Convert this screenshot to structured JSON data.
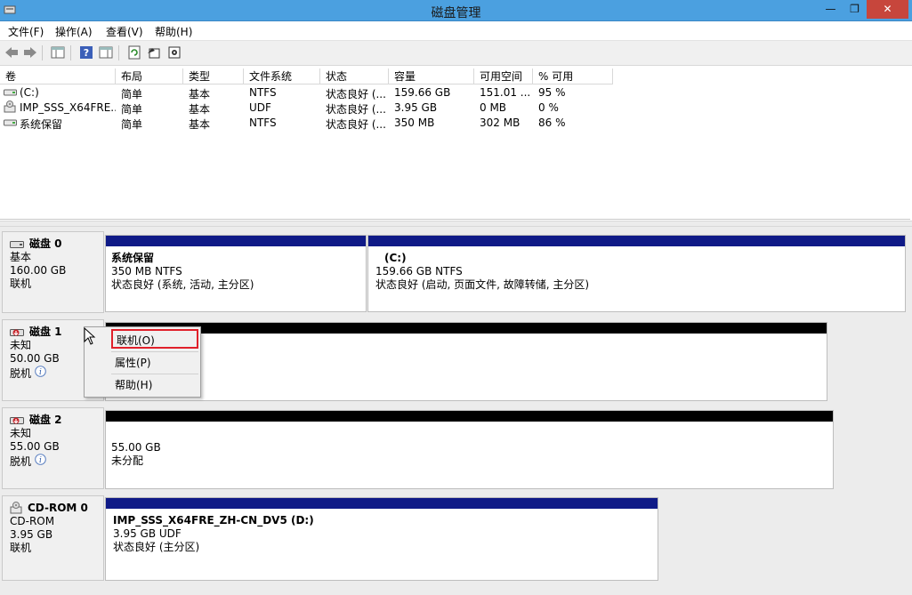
{
  "window": {
    "title": "磁盘管理",
    "min": "—",
    "max": "❐",
    "close": "✕"
  },
  "menu": [
    "文件(F)",
    "操作(A)",
    "查看(V)",
    "帮助(H)"
  ],
  "columns": [
    "卷",
    "布局",
    "类型",
    "文件系统",
    "状态",
    "容量",
    "可用空间",
    "% 可用"
  ],
  "volumes": [
    {
      "name": "(C:)",
      "layout": "简单",
      "type": "基本",
      "fs": "NTFS",
      "status": "状态良好 (...",
      "capacity": "159.66 GB",
      "free": "151.01 ...",
      "pct": "95 %",
      "icon": "drive-icon"
    },
    {
      "name": "IMP_SSS_X64FRE...",
      "layout": "简单",
      "type": "基本",
      "fs": "UDF",
      "status": "状态良好 (...",
      "capacity": "3.95 GB",
      "free": "0 MB",
      "pct": "0 %",
      "icon": "cdrom-icon"
    },
    {
      "name": "系统保留",
      "layout": "简单",
      "type": "基本",
      "fs": "NTFS",
      "status": "状态良好 (...",
      "capacity": "350 MB",
      "free": "302 MB",
      "pct": "86 %",
      "icon": "drive-icon"
    }
  ],
  "disks": [
    {
      "name": "磁盘 0",
      "type": "基本",
      "size": "160.00 GB",
      "state": "联机",
      "partitions": [
        {
          "name": "系统保留",
          "size": "350 MB NTFS",
          "status": "状态良好 (系统, 活动, 主分区)"
        },
        {
          "name": "(C:)",
          "size": "159.66 GB NTFS",
          "status": "状态良好 (启动, 页面文件, 故障转储, 主分区)"
        }
      ]
    },
    {
      "name": "磁盘 1",
      "type": "未知",
      "size": "50.00 GB",
      "state": "脱机"
    },
    {
      "name": "磁盘 2",
      "type": "未知",
      "size": "55.00 GB",
      "state": "脱机",
      "partitions": [
        {
          "size": "55.00 GB",
          "status": "未分配"
        }
      ]
    },
    {
      "name": "CD-ROM 0",
      "type": "CD-ROM",
      "size": "3.95 GB",
      "state": "联机",
      "partitions": [
        {
          "name": "IMP_SSS_X64FRE_ZH-CN_DV5  (D:)",
          "size": "3.95 GB UDF",
          "status": "状态良好 (主分区)"
        }
      ]
    }
  ],
  "context_menu": {
    "online": "联机(O)",
    "properties": "属性(P)",
    "help": "帮助(H)"
  },
  "colors": {
    "primary_partition": "#0f1a87",
    "unallocated": "#000000",
    "highlight_border": "#e0202a"
  }
}
